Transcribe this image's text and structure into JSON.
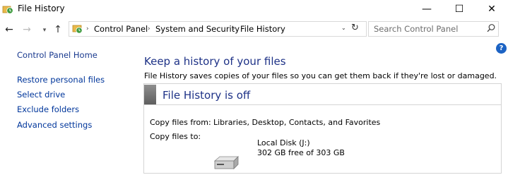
{
  "window": {
    "title": "File History",
    "minimize_glyph": "—",
    "maximize_glyph": "☐",
    "close_glyph": "✕"
  },
  "nav": {
    "back_glyph": "←",
    "forward_glyph": "→",
    "recent_glyph": "▾",
    "up_glyph": "↑",
    "breadcrumbs": [
      "Control Panel",
      "System and Security",
      "File History"
    ],
    "separator": "›",
    "dropdown_glyph": "⌄",
    "refresh_glyph": "↻",
    "search_placeholder": "Search Control Panel"
  },
  "sidebar": {
    "home_link": "Control Panel Home",
    "links": [
      "Restore personal files",
      "Select drive",
      "Exclude folders",
      "Advanced settings"
    ]
  },
  "main": {
    "help_glyph": "?",
    "heading": "Keep a history of your files",
    "description": "File History saves copies of your files so you can get them back if they're lost or damaged.",
    "status_title": "File History is off",
    "copy_from_label": "Copy files from:",
    "copy_from_value": "Libraries, Desktop, Contacts, and Favorites",
    "copy_to_label": "Copy files to:",
    "drive_name": "Local Disk (J:)",
    "drive_space": "302 GB free of 303 GB"
  },
  "colors": {
    "link": "#00369b",
    "heading": "#1e3287",
    "help_badge": "#1c63c4"
  },
  "icons": {
    "app": "file-history-icon",
    "address": "control-panel-icon",
    "search": "search-icon",
    "drive": "hard-drive-icon"
  }
}
